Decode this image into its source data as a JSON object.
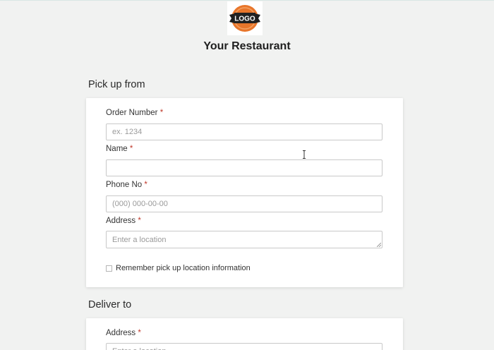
{
  "header": {
    "logo_text": "LOGO",
    "restaurant_name": "Your Restaurant"
  },
  "pickup": {
    "heading": "Pick up from",
    "order_number": {
      "label": "Order Number",
      "required_mark": "*",
      "placeholder": "ex. 1234",
      "value": ""
    },
    "name": {
      "label": "Name",
      "required_mark": "*",
      "placeholder": "",
      "value": ""
    },
    "phone": {
      "label": "Phone No",
      "required_mark": "*",
      "placeholder": "(000) 000-00-00",
      "value": ""
    },
    "address": {
      "label": "Address",
      "required_mark": "*",
      "placeholder": "Enter a location",
      "value": ""
    },
    "remember": {
      "label": "Remember pick up location information",
      "checked": false
    }
  },
  "delivery": {
    "heading": "Deliver to",
    "address": {
      "label": "Address",
      "required_mark": "*",
      "placeholder": "Enter a location",
      "value": ""
    }
  },
  "colors": {
    "background": "#f1f2f1",
    "card": "#ffffff",
    "required": "#c0392b",
    "logo_orange": "#e8762b",
    "logo_banner": "#222222"
  }
}
